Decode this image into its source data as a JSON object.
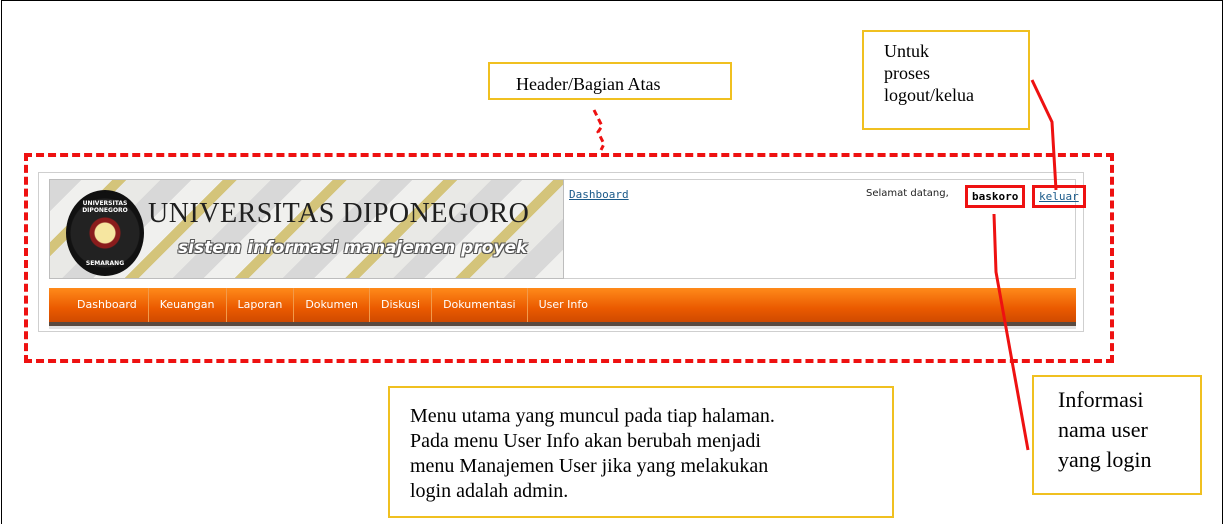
{
  "callouts": {
    "header": "Header/Bagian Atas",
    "logout": [
      "Untuk",
      "proses",
      "logout/kelua"
    ],
    "user_info": [
      "Informasi",
      "nama user",
      "yang login"
    ],
    "menu": [
      "Menu utama yang muncul pada tiap  halaman.",
      "Pada menu User Info akan berubah menjadi",
      "menu Manajemen User jika yang melakukan",
      "login adalah admin."
    ]
  },
  "banner": {
    "title": "UNIVERSITAS DIPONEGORO",
    "subtitle": "sistem informasi manajemen proyek",
    "seal_top": "UNIVERSITAS DIPONEGORO",
    "seal_bottom": "SEMARANG"
  },
  "topbar": {
    "dashboard_link": "Dashboard",
    "welcome": "Selamat datang,",
    "username": "baskoro",
    "logout": "keluar"
  },
  "nav": [
    "Dashboard",
    "Keuangan",
    "Laporan",
    "Dokumen",
    "Diskusi",
    "Dokumentasi",
    "User Info"
  ],
  "colors": {
    "annotation_red": "#e11111",
    "callout_border": "#f0c020",
    "nav_orange": "#ea5a00",
    "link_blue": "#1a5a8a"
  }
}
